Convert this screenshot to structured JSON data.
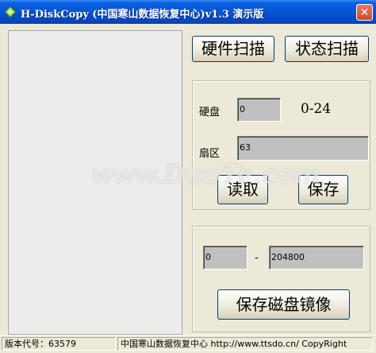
{
  "window": {
    "title": "H-DiskCopy (中国寒山数据恢复中心)v1.3 演示版",
    "close_symbol": "✕"
  },
  "buttons": {
    "hardware_scan": "硬件扫描",
    "status_scan": "状态扫描",
    "read": "读取",
    "save": "保存",
    "save_image": "保存磁盘镜像"
  },
  "sector_group": {
    "disk_label": "硬盘",
    "disk_value": "0",
    "disk_range": "0-24",
    "sector_label": "扇区",
    "sector_value": "63"
  },
  "image_group": {
    "start_value": "0",
    "separator": "-",
    "end_value": "204800"
  },
  "statusbar": {
    "version": "版本代号：63579",
    "info": "中国寒山数据恢复中心 http://www.ttsdo.cn/ CopyRight"
  },
  "colors": {
    "titlebar": "#0655d6",
    "face": "#ece9d8",
    "field": "#c0c0c0",
    "button_border": "#003c74"
  },
  "icons": {
    "app": "diamond-disk-icon",
    "close": "close-icon"
  }
}
